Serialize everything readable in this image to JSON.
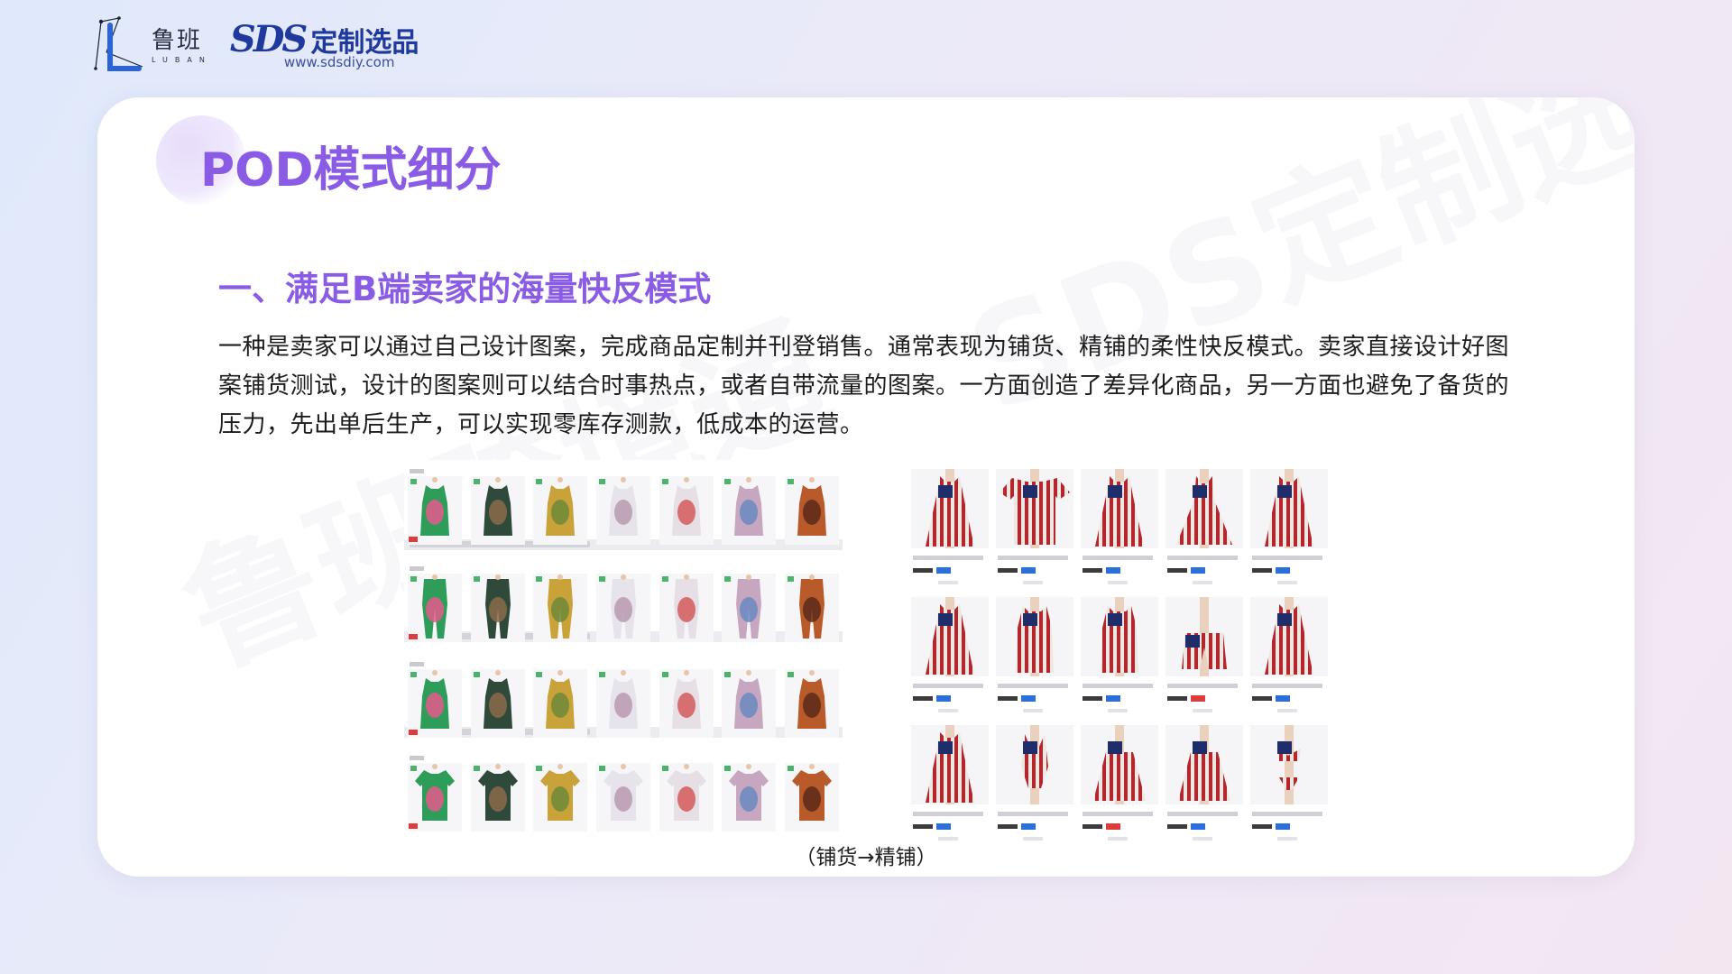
{
  "header": {
    "luban_cn": "鲁班",
    "luban_en": "LUBAN",
    "sds_mark": "SDS",
    "sds_name": "定制选品",
    "sds_url": "www.sdsdiy.com"
  },
  "slide": {
    "title": "POD模式细分",
    "section_heading": "一、满足B端卖家的海量快反模式",
    "body": "一种是卖家可以通过自己设计图案，完成商品定制并刊登销售。通常表现为铺货、精铺的柔性快反模式。卖家直接设计好图案铺货测试，设计的图案则可以结合时事热点，或者自带流量的图案。一方面创造了差异化商品，另一方面也避免了备货的压力，先出单后生产，可以实现零库存测款，低成本的运营。",
    "caption": "（铺货→精铺）",
    "watermark_left": "鲁班跨境通",
    "watermark_right": "SDS定制选品"
  },
  "colors": {
    "accent": "#8a5ce6",
    "brand_blue": "#1f3a9c",
    "text": "#1c1c1c"
  },
  "products": {
    "left_palettes": [
      [
        "#2f9d5a",
        "#e45a8c"
      ],
      [
        "#2f4a3a",
        "#8b6b4a"
      ],
      [
        "#c9a23a",
        "#6e8a3a"
      ],
      [
        "#e7e3ea",
        "#b89ab0"
      ],
      [
        "#e6e0e6",
        "#d45a5a"
      ],
      [
        "#c7a7c0",
        "#6b8ac0"
      ],
      [
        "#b85a2a",
        "#5a2a1a"
      ]
    ],
    "right_variants": [
      "dress",
      "tee",
      "dress",
      "skirt-dress",
      "dress",
      "dress",
      "tank",
      "tank",
      "shorts",
      "dress",
      "dress",
      "swimsuit",
      "skirt",
      "skirt",
      "bikini"
    ]
  }
}
